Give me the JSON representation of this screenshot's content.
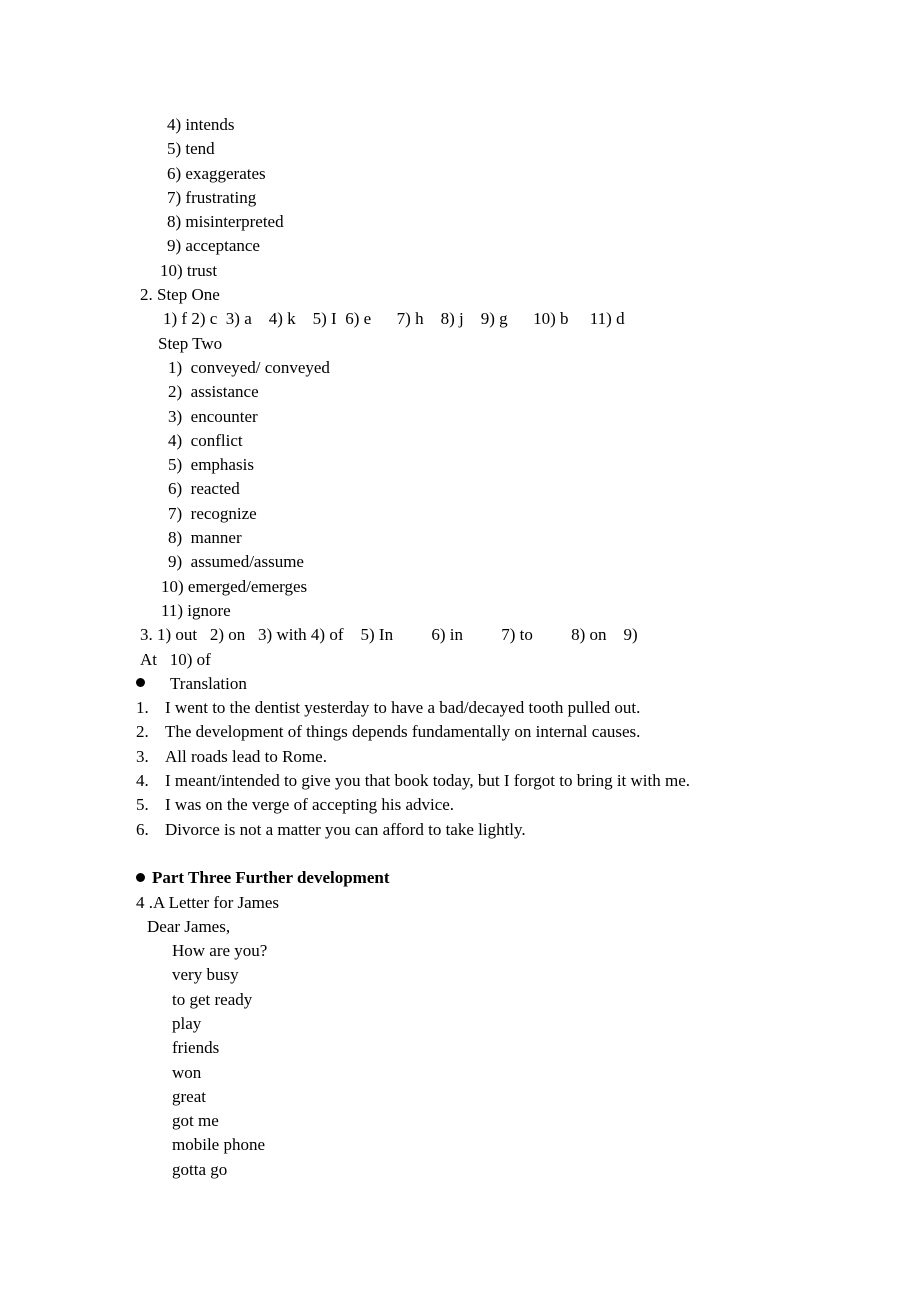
{
  "document": {
    "vocab_list_continued": [
      "4) intends",
      "5) tend",
      "6) exaggerates",
      "7) frustrating",
      "8) misinterpreted",
      "9) acceptance"
    ],
    "vocab_list_item_10": "10) trust",
    "section_2": {
      "heading": "2. Step One",
      "step_one_answers": "1) f 2) c  3) a    4) k    5) I  6) e      7) h    8) j    9) g      10) b     11) d",
      "step_two_heading": "Step Two",
      "step_two_items": [
        "1)  conveyed/ conveyed",
        "2)  assistance",
        "3)  encounter",
        "4)  conflict",
        "5)  emphasis",
        "6)  reacted",
        "7)  recognize",
        "8)  manner",
        "9)  assumed/assume"
      ],
      "step_two_item_10": "10) emerged/emerges",
      "step_two_item_11": "11) ignore"
    },
    "section_3": {
      "line_1": "3. 1) out   2) on   3) with 4) of    5) In         6) in         7) to         8) on    9)",
      "line_2": "At   10) of"
    },
    "translation": {
      "heading": "Translation",
      "items": [
        {
          "num": "1.",
          "text": "I went to the dentist yesterday to have a bad/decayed tooth pulled out."
        },
        {
          "num": "2.",
          "text": "The development of things depends fundamentally on internal causes."
        },
        {
          "num": "3.",
          "text": "All roads lead to Rome."
        },
        {
          "num": "4.",
          "text": "I meant/intended to give you that book today, but I forgot to bring it with me."
        },
        {
          "num": "5.",
          "text": "I was on the verge of accepting his advice."
        },
        {
          "num": "6.",
          "text": "Divorce is not a matter you can afford to take lightly."
        }
      ]
    },
    "part_three": {
      "heading": "Part Three Further development",
      "letter_title": "4 .A Letter for James",
      "salutation": "Dear James,",
      "body_lines": [
        "How are you?",
        "very busy",
        "to get ready",
        "play",
        "friends",
        "won",
        "great",
        "got me",
        "mobile phone",
        "gotta go"
      ]
    }
  }
}
